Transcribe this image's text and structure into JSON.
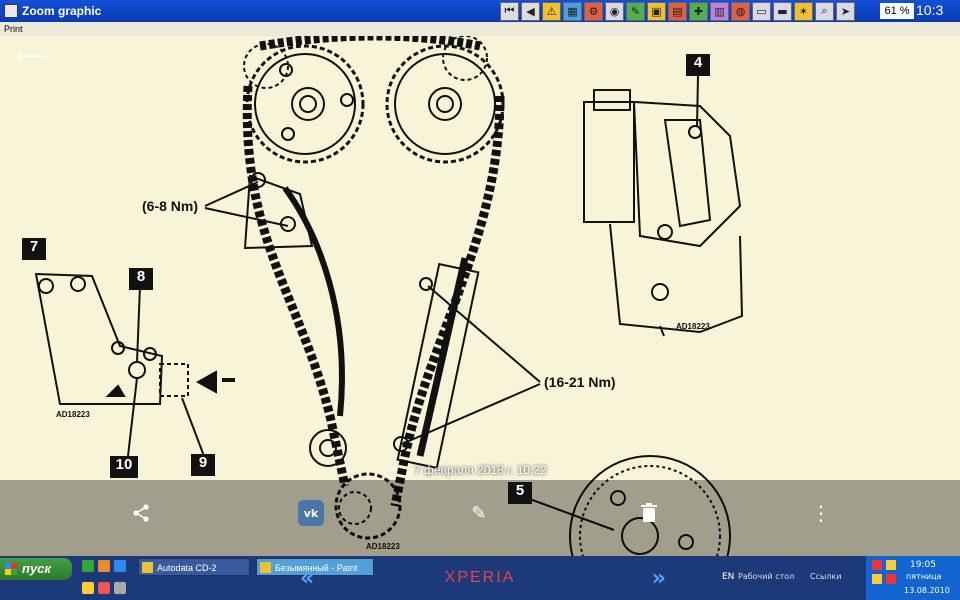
{
  "window": {
    "title": "Zoom graphic",
    "menu_print": "Print",
    "zoom_percent": "61 %",
    "clock": "10:3"
  },
  "drawing": {
    "callouts": {
      "c4": "4",
      "c5": "5",
      "c7": "7",
      "c8": "8",
      "c9": "9",
      "c10": "10"
    },
    "torque_top": "(6-8 Nm)",
    "torque_bottom": "(16-21 Nm)",
    "ad_codes": [
      "AD18223",
      "AD18223",
      "AD18223"
    ]
  },
  "viewer": {
    "timestamp": "7 февраля 2018 г. 10:22",
    "vk_label": "vk"
  },
  "taskbar": {
    "start_label": "пуск",
    "tasks": [
      "Autodata CD-2",
      "Безымянный - Paint"
    ],
    "brand": "XPERIA",
    "lang": "EN",
    "desktop": "Рабочий стол",
    "links": "Ссылки",
    "clock": "19:05",
    "day": "пятница",
    "date": "13.08.2010"
  },
  "colors": {
    "titlebar": "#1450d8",
    "paper": "#f8f4d8",
    "brand": "#e6404a",
    "nav_arrow": "#4ea6ff"
  }
}
